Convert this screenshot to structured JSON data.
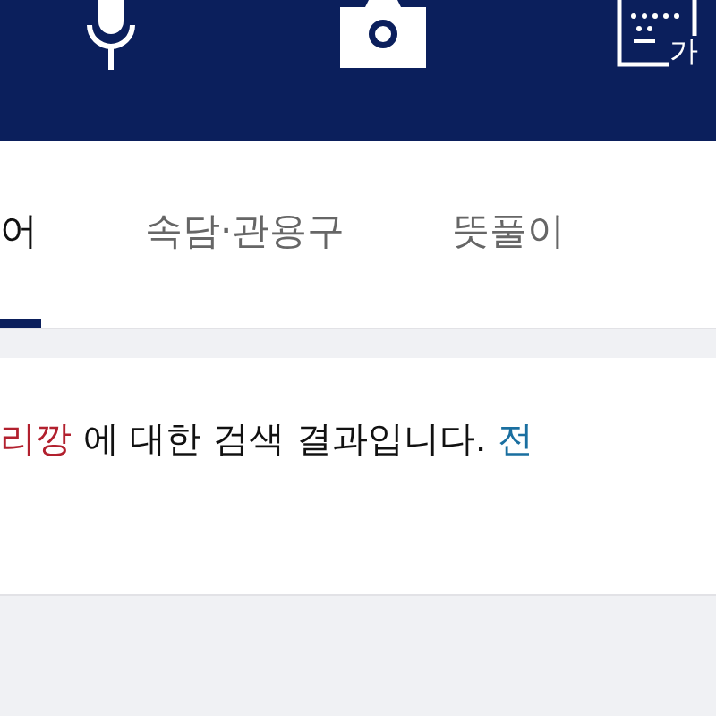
{
  "toolbar": {
    "buttons": [
      {
        "kind": "mic"
      },
      {
        "kind": "camera"
      },
      {
        "kind": "keyboard",
        "label": "가"
      }
    ]
  },
  "tabs": [
    {
      "label": "어",
      "selected": true
    },
    {
      "label": "속담·관용구",
      "selected": false
    },
    {
      "label": "뜻풀이",
      "selected": false
    }
  ],
  "result": {
    "query": "리깡",
    "text": " 에 대한 검색 결과입니다. ",
    "link": "전"
  }
}
